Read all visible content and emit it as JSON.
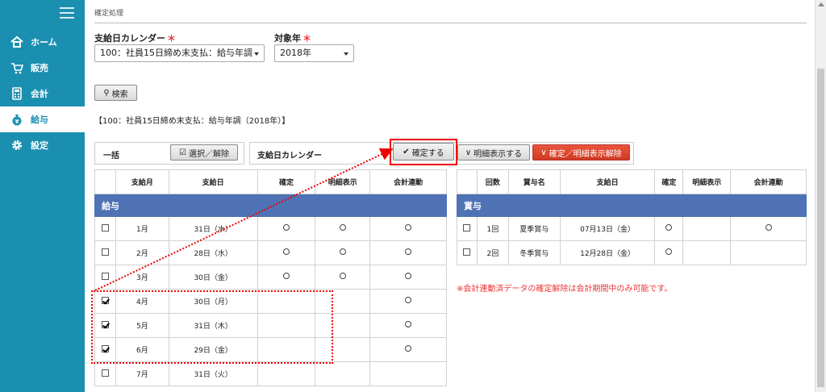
{
  "sidebar": {
    "items": [
      {
        "label": "ホーム",
        "icon": "home-icon"
      },
      {
        "label": "販売",
        "icon": "cart-icon"
      },
      {
        "label": "会計",
        "icon": "calculator-icon"
      },
      {
        "label": "給与",
        "icon": "money-bag-icon"
      },
      {
        "label": "設定",
        "icon": "gear-icon"
      }
    ],
    "active": "給与"
  },
  "breadcrumb": "確定処理",
  "filters": {
    "calendar_label": "支給日カレンダー",
    "calendar_value": "100：社員15日締め末支払：給与年調",
    "year_label": "対象年",
    "year_value": "2018年",
    "required_mark": "＊"
  },
  "search_button": "検索",
  "summary": "【100：社員15日締め末支払：給与年調（2018年）】",
  "batch": {
    "label": "一括",
    "select_button": "選択／解除",
    "calendar_label": "支給日カレンダー",
    "confirm_button": "確定する",
    "show_detail_button": "明細表示する",
    "cancel_button": "確定／明細表示解除"
  },
  "salary_table": {
    "title": "給与",
    "headers": [
      "",
      "支給月",
      "支給日",
      "確定",
      "明細表示",
      "会計連動"
    ],
    "rows": [
      {
        "checked": false,
        "month": "1月",
        "date": "31日（水）",
        "confirmed": true,
        "detail": true,
        "linked": true
      },
      {
        "checked": false,
        "month": "2月",
        "date": "28日（水）",
        "confirmed": true,
        "detail": true,
        "linked": true
      },
      {
        "checked": false,
        "month": "3月",
        "date": "30日（金）",
        "confirmed": true,
        "detail": true,
        "linked": true
      },
      {
        "checked": true,
        "month": "4月",
        "date": "30日（月）",
        "confirmed": false,
        "detail": false,
        "linked": true
      },
      {
        "checked": true,
        "month": "5月",
        "date": "31日（木）",
        "confirmed": false,
        "detail": false,
        "linked": true
      },
      {
        "checked": true,
        "month": "6月",
        "date": "29日（金）",
        "confirmed": false,
        "detail": false,
        "linked": true
      },
      {
        "checked": false,
        "month": "7月",
        "date": "31日（火）",
        "confirmed": false,
        "detail": false,
        "linked": false
      }
    ]
  },
  "bonus_table": {
    "title": "賞与",
    "headers": [
      "",
      "回数",
      "賞与名",
      "支給日",
      "確定",
      "明細表示",
      "会計連動"
    ],
    "rows": [
      {
        "checked": false,
        "count": "1回",
        "name": "夏季賞与",
        "date": "07月13日（金）",
        "confirmed": true,
        "detail": false,
        "linked": true
      },
      {
        "checked": false,
        "count": "2回",
        "name": "冬季賞与",
        "date": "12月28日（金）",
        "confirmed": true,
        "detail": false,
        "linked": false
      }
    ]
  },
  "note": "※会計連動済データの確定解除は会計期間中のみ可能です。"
}
